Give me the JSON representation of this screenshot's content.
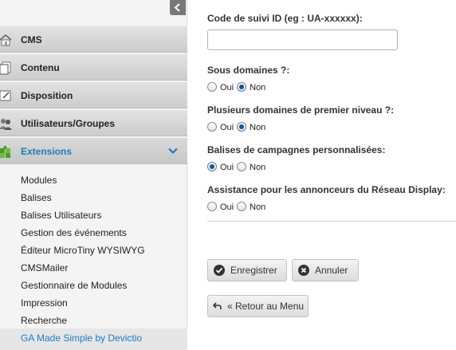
{
  "sidebar": {
    "items": [
      {
        "label": "CMS",
        "icon": "home-icon"
      },
      {
        "label": "Contenu",
        "icon": "content-icon"
      },
      {
        "label": "Disposition",
        "icon": "layout-icon"
      },
      {
        "label": "Utilisateurs/Groupes",
        "icon": "users-icon"
      },
      {
        "label": "Extensions",
        "icon": "puzzle-icon"
      }
    ],
    "subitems": [
      "Modules",
      "Balises",
      "Balises Utilisateurs",
      "Gestion des événements",
      "Éditeur MicroTiny WYSIWYG",
      "CMSMailer",
      "Gestionnaire de Modules",
      "Impression",
      "Recherche",
      "GA Made Simple by Devictio"
    ]
  },
  "form": {
    "tracking_label": "Code de suivi ID (eg : UA-xxxxxx):",
    "tracking_value": "",
    "subdomains_label": "Sous domaines ?:",
    "multi_domains_label": "Plusieurs domaines de premier niveau ?:",
    "campaign_tags_label": "Balises de campagnes personnalisées:",
    "display_network_label": "Assistance pour les annonceurs du Réseau Display:",
    "yes": "Oui",
    "no": "Non",
    "subdomains_value": "Non",
    "multi_domains_value": "Non",
    "campaign_tags_value": "Oui",
    "display_network_value": "Non"
  },
  "buttons": {
    "save": "Enregistrer",
    "cancel": "Annuler",
    "back": "« Retour au Menu"
  },
  "colors": {
    "accent": "#1f7bc1",
    "sidebar_bg": "#f4f4f4"
  }
}
